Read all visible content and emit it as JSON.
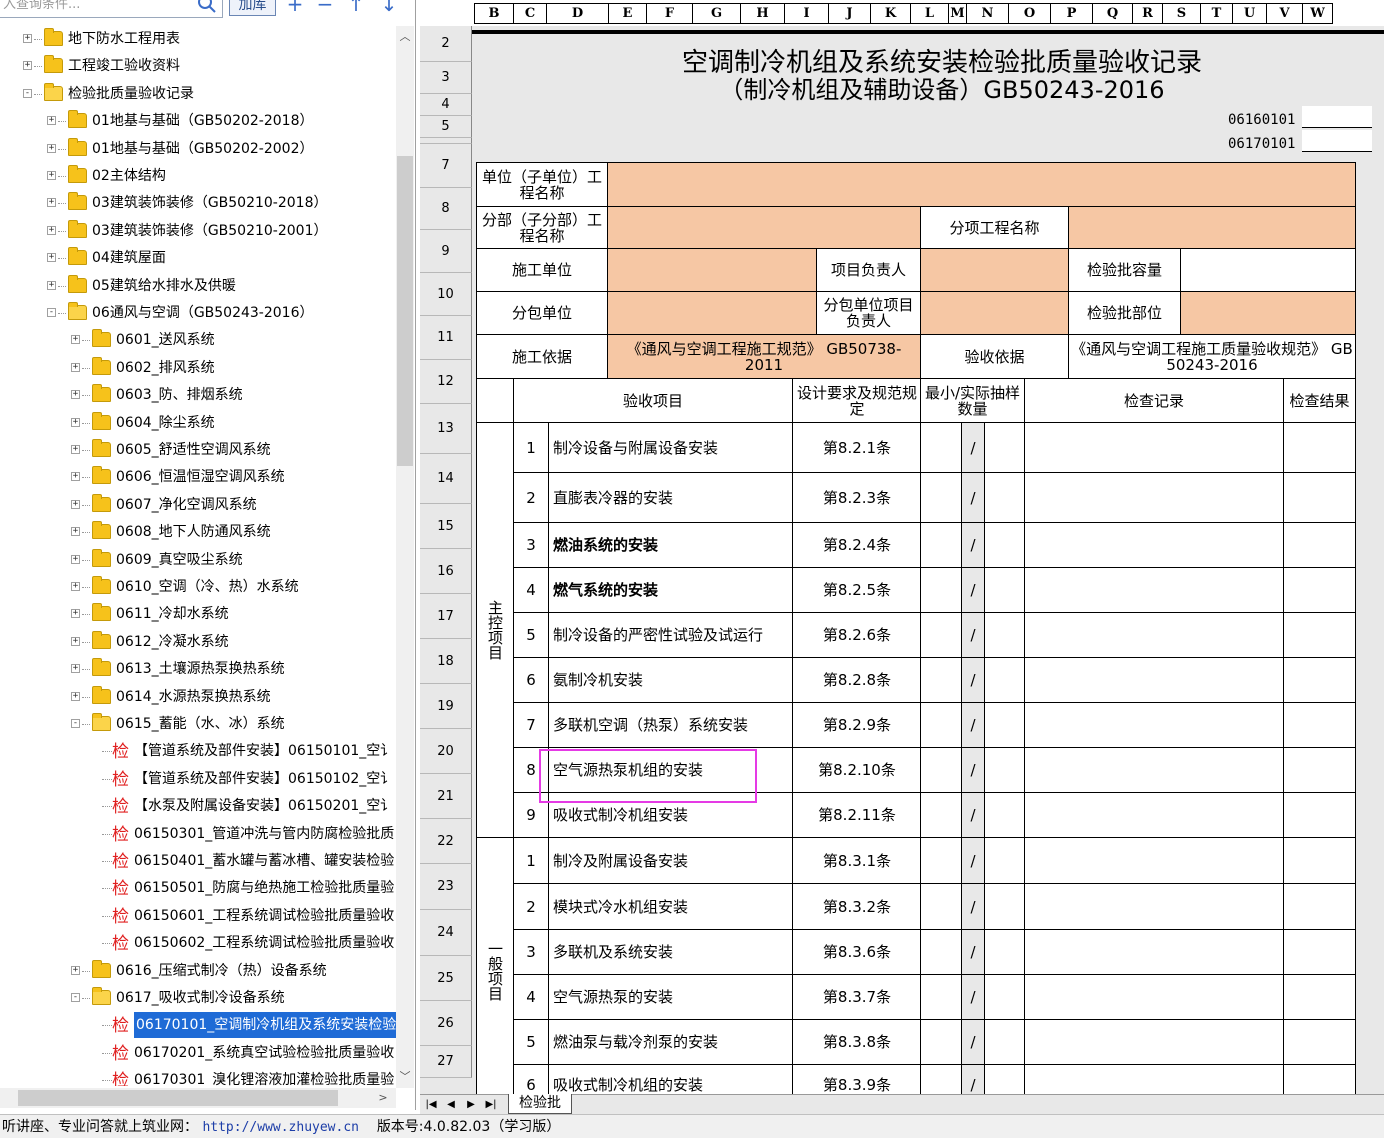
{
  "left_panel": {
    "search_placeholder": "入查询条件...",
    "add_button": "加库",
    "tree": [
      {
        "label": "地下防水工程用表",
        "level": 1,
        "type": "folder",
        "expander": "+"
      },
      {
        "label": "工程竣工验收资料",
        "level": 1,
        "type": "folder",
        "expander": "+"
      },
      {
        "label": "检验批质量验收记录",
        "level": 1,
        "type": "folder-open",
        "expander": "-"
      },
      {
        "label": "01地基与基础（GB50202-2018）",
        "level": 2,
        "type": "folder",
        "expander": "+"
      },
      {
        "label": "01地基与基础（GB50202-2002）",
        "level": 2,
        "type": "folder",
        "expander": "+"
      },
      {
        "label": "02主体结构",
        "level": 2,
        "type": "folder",
        "expander": "+"
      },
      {
        "label": "03建筑装饰装修（GB50210-2018）",
        "level": 2,
        "type": "folder",
        "expander": "+"
      },
      {
        "label": "03建筑装饰装修（GB50210-2001）",
        "level": 2,
        "type": "folder",
        "expander": "+"
      },
      {
        "label": "04建筑屋面",
        "level": 2,
        "type": "folder",
        "expander": "+"
      },
      {
        "label": "05建筑给水排水及供暖",
        "level": 2,
        "type": "folder",
        "expander": "+"
      },
      {
        "label": "06通风与空调（GB50243-2016）",
        "level": 2,
        "type": "folder-open",
        "expander": "-"
      },
      {
        "label": "0601_送风系统",
        "level": 3,
        "type": "folder",
        "expander": "+"
      },
      {
        "label": "0602_排风系统",
        "level": 3,
        "type": "folder",
        "expander": "+"
      },
      {
        "label": "0603_防、排烟系统",
        "level": 3,
        "type": "folder",
        "expander": "+"
      },
      {
        "label": "0604_除尘系统",
        "level": 3,
        "type": "folder",
        "expander": "+"
      },
      {
        "label": "0605_舒适性空调风系统",
        "level": 3,
        "type": "folder",
        "expander": "+"
      },
      {
        "label": "0606_恒温恒湿空调风系统",
        "level": 3,
        "type": "folder",
        "expander": "+"
      },
      {
        "label": "0607_净化空调风系统",
        "level": 3,
        "type": "folder",
        "expander": "+"
      },
      {
        "label": "0608_地下人防通风系统",
        "level": 3,
        "type": "folder",
        "expander": "+"
      },
      {
        "label": "0609_真空吸尘系统",
        "level": 3,
        "type": "folder",
        "expander": "+"
      },
      {
        "label": "0610_空调（冷、热）水系统",
        "level": 3,
        "type": "folder",
        "expander": "+"
      },
      {
        "label": "0611_冷却水系统",
        "level": 3,
        "type": "folder",
        "expander": "+"
      },
      {
        "label": "0612_冷凝水系统",
        "level": 3,
        "type": "folder",
        "expander": "+"
      },
      {
        "label": "0613_土壤源热泵换热系统",
        "level": 3,
        "type": "folder",
        "expander": "+"
      },
      {
        "label": "0614_水源热泵换热系统",
        "level": 3,
        "type": "folder",
        "expander": "+"
      },
      {
        "label": "0615_蓄能（水、冰）系统",
        "level": 3,
        "type": "folder-open",
        "expander": "-"
      },
      {
        "label": "【管道系统及部件安装】06150101_空讠",
        "level": 4,
        "type": "doc"
      },
      {
        "label": "【管道系统及部件安装】06150102_空讠",
        "level": 4,
        "type": "doc"
      },
      {
        "label": "【水泵及附属设备安装】06150201_空讠",
        "level": 4,
        "type": "doc"
      },
      {
        "label": "06150301_管道冲洗与管内防腐检验批质",
        "level": 4,
        "type": "doc"
      },
      {
        "label": "06150401_蓄水罐与蓄冰槽、罐安装检验",
        "level": 4,
        "type": "doc"
      },
      {
        "label": "06150501_防腐与绝热施工检验批质量验",
        "level": 4,
        "type": "doc"
      },
      {
        "label": "06150601_工程系统调试检验批质量验收",
        "level": 4,
        "type": "doc"
      },
      {
        "label": "06150602_工程系统调试检验批质量验收",
        "level": 4,
        "type": "doc"
      },
      {
        "label": "0616_压缩式制冷（热）设备系统",
        "level": 3,
        "type": "folder",
        "expander": "+"
      },
      {
        "label": "0617_吸收式制冷设备系统",
        "level": 3,
        "type": "folder-open",
        "expander": "-"
      },
      {
        "label": "06170101_空调制冷机组及系统安装检验",
        "level": 4,
        "type": "doc",
        "selected": true
      },
      {
        "label": "06170201_系统真空试验检验批质量验收",
        "level": 4,
        "type": "doc"
      },
      {
        "label": "06170301_溴化锂溶液加灌检验批质量验",
        "level": 4,
        "type": "doc"
      }
    ],
    "doc_glyph": "检"
  },
  "sheet": {
    "columns": [
      "B",
      "C",
      "D",
      "E",
      "F",
      "G",
      "H",
      "I",
      "J",
      "K",
      "L",
      "M",
      "N",
      "O",
      "P",
      "Q",
      "R",
      "S",
      "T",
      "U",
      "V",
      "W"
    ],
    "rows": [
      "2",
      "3",
      "4",
      "5",
      "6",
      "7",
      "8",
      "9",
      "10",
      "11",
      "12",
      "13",
      "14",
      "15",
      "16",
      "17",
      "18",
      "19",
      "20",
      "21",
      "22",
      "23",
      "24",
      "25",
      "26",
      "27"
    ],
    "title1": "空调制冷机组及系统安装检验批质量验收记录",
    "title2": "（制冷机组及辅助设备）GB50243-2016",
    "code1": "06160101",
    "code2": "06170101",
    "header": {
      "unit_label": "单位（子单位）工程名称",
      "division_label": "分部（子分部）工程名称",
      "subitem_label": "分项工程名称",
      "constructor_label": "施工单位",
      "project_lead_label": "项目负责人",
      "batch_capacity_label": "检验批容量",
      "subcontractor_label": "分包单位",
      "sub_project_lead_label": "分包单位项目负责人",
      "batch_location_label": "检验批部位",
      "basis_label": "施工依据",
      "basis_value": "《通风与空调工程施工规范》 GB50738-2011",
      "acceptance_label": "验收依据",
      "acceptance_value": "《通风与空调工程施工质量验收规范》 GB 50243-2016"
    },
    "table_head": {
      "item": "验收项目",
      "design": "设计要求及规范规定",
      "sample": "最小/实际抽样数量",
      "record": "检查记录",
      "result": "检查结果"
    },
    "main_group_label": "主控项目",
    "general_group_label": "一般项目",
    "main_items": [
      {
        "no": "1",
        "name": "制冷设备与附属设备安装",
        "clause": "第8.2.1条",
        "bold": false
      },
      {
        "no": "2",
        "name": "直膨表冷器的安装",
        "clause": "第8.2.3条",
        "bold": false
      },
      {
        "no": "3",
        "name": "燃油系统的安装",
        "clause": "第8.2.4条",
        "bold": true
      },
      {
        "no": "4",
        "name": "燃气系统的安装",
        "clause": "第8.2.5条",
        "bold": true
      },
      {
        "no": "5",
        "name": "制冷设备的严密性试验及试运行",
        "clause": "第8.2.6条",
        "bold": false
      },
      {
        "no": "6",
        "name": "氨制冷机安装",
        "clause": "第8.2.8条",
        "bold": false
      },
      {
        "no": "7",
        "name": "多联机空调（热泵）系统安装",
        "clause": "第8.2.9条",
        "bold": false
      },
      {
        "no": "8",
        "name": "空气源热泵机组的安装",
        "clause": "第8.2.10条",
        "bold": false
      },
      {
        "no": "9",
        "name": "吸收式制冷机组安装",
        "clause": "第8.2.11条",
        "bold": false
      }
    ],
    "general_items": [
      {
        "no": "1",
        "name": "制冷及附属设备安装",
        "clause": "第8.3.1条"
      },
      {
        "no": "2",
        "name": "模块式冷水机组安装",
        "clause": "第8.3.2条"
      },
      {
        "no": "3",
        "name": "多联机及系统安装",
        "clause": "第8.3.6条"
      },
      {
        "no": "4",
        "name": "空气源热泵的安装",
        "clause": "第8.3.7条"
      },
      {
        "no": "5",
        "name": "燃油泵与载冷剂泵的安装",
        "clause": "第8.3.8条"
      },
      {
        "no": "6",
        "name": "吸收式制冷机组的安装",
        "clause": "第8.3.9条"
      }
    ],
    "slash": "/",
    "sheet_tab": "检验批"
  },
  "status_bar": {
    "prefix": "听讲座、专业问答就上筑业网：",
    "url": "http://www.zhuyew.cn",
    "version": "版本号:4.0.82.03（学习版）"
  },
  "colors": {
    "tan": "#f6c7a4",
    "highlight": "#e53ae5",
    "selection": "#1f6bd6"
  }
}
